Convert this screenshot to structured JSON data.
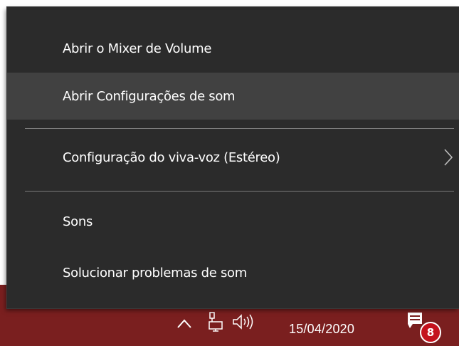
{
  "menu": {
    "items": [
      {
        "label": "Abrir o Mixer de Volume",
        "has_submenu": false
      },
      {
        "label": "Abrir Configurações de som",
        "has_submenu": false,
        "highlighted": true
      },
      {
        "label": "Configuração do viva-voz (Estéreo)",
        "has_submenu": true
      },
      {
        "label": "Sons",
        "has_submenu": false
      },
      {
        "label": "Solucionar problemas de som",
        "has_submenu": false
      }
    ]
  },
  "taskbar": {
    "date": "15/04/2020",
    "notification_count": "8",
    "icons": [
      "chevron-up-icon",
      "network-icon",
      "speaker-icon",
      "notification-icon"
    ],
    "background_color": "#7a1f1f"
  },
  "colors": {
    "menu_background": "#2b2b2b",
    "menu_hover": "#414141",
    "menu_text": "#ffffff",
    "separator": "#7b7b7b",
    "badge": "#c4121d"
  }
}
